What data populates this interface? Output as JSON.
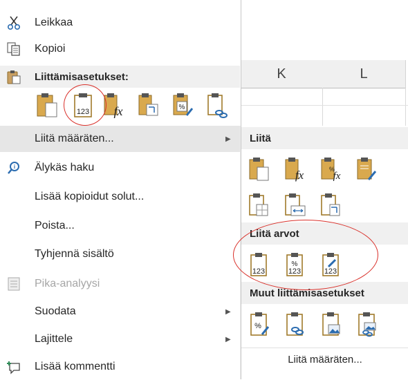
{
  "sheet": {
    "col_k": "K",
    "col_l": "L"
  },
  "menu": {
    "cut": "Leikkaa",
    "copy": "Kopioi",
    "paste_options": "Liittämisasetukset:",
    "paste_special": "Liitä määräten...",
    "smart_lookup": "Älykäs haku",
    "insert_copied": "Lisää kopioidut solut...",
    "delete": "Poista...",
    "clear": "Tyhjennä sisältö",
    "quick_analysis": "Pika-analyysi",
    "filter": "Suodata",
    "sort": "Lajittele",
    "insert_comment": "Lisää kommentti"
  },
  "submenu": {
    "paste_header": "Liitä",
    "paste_values_header": "Liitä arvot",
    "other_header": "Muut liittämisasetukset",
    "paste_special_link": "Liitä määräten..."
  },
  "icon_text": {
    "values": "123",
    "percent": "%",
    "fx": "fx"
  },
  "colors": {
    "accent": "#c28a00",
    "highlight_oval": "#d9302a",
    "header_bg": "#f0f0f0",
    "hover_bg": "#e6e6e6"
  }
}
